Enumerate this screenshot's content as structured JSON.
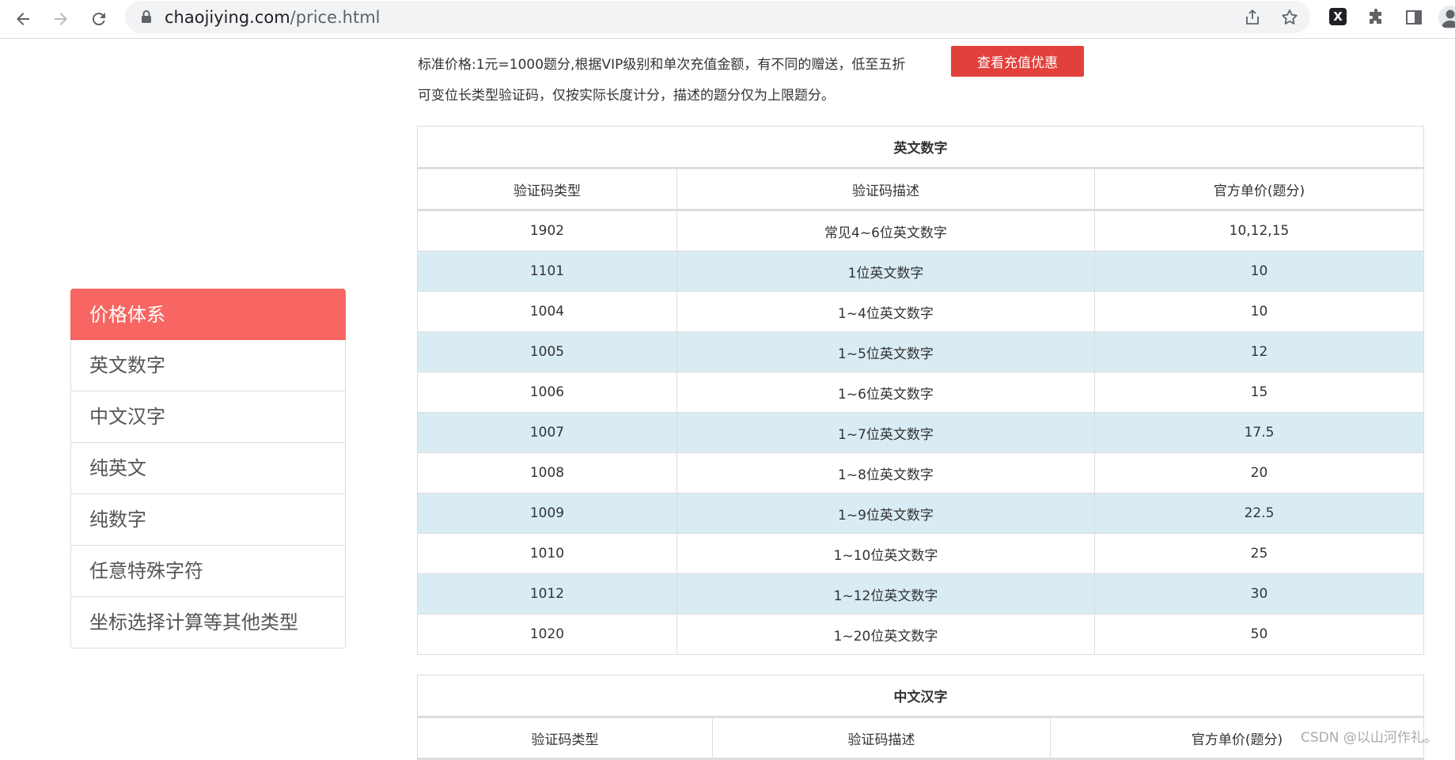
{
  "browser": {
    "url_host": "chaojiying.com",
    "url_path": "/price.html"
  },
  "intro": {
    "line1": "标准价格:1元=1000题分,根据VIP级别和单次充值金额，有不同的赠送，低至五折",
    "line2": "可变位长类型验证码，仅按实际长度计分，描述的题分仅为上限题分。",
    "button_label": "查看充值优惠"
  },
  "sidebar": {
    "items": [
      {
        "label": "价格体系"
      },
      {
        "label": "英文数字"
      },
      {
        "label": "中文汉字"
      },
      {
        "label": "纯英文"
      },
      {
        "label": "纯数字"
      },
      {
        "label": "任意特殊字符"
      },
      {
        "label": "坐标选择计算等其他类型"
      }
    ]
  },
  "tables": [
    {
      "title": "英文数字",
      "headers": [
        "验证码类型",
        "验证码描述",
        "官方单价(题分)"
      ],
      "rows": [
        [
          "1902",
          "常见4~6位英文数字",
          "10,12,15"
        ],
        [
          "1101",
          "1位英文数字",
          "10"
        ],
        [
          "1004",
          "1~4位英文数字",
          "10"
        ],
        [
          "1005",
          "1~5位英文数字",
          "12"
        ],
        [
          "1006",
          "1~6位英文数字",
          "15"
        ],
        [
          "1007",
          "1~7位英文数字",
          "17.5"
        ],
        [
          "1008",
          "1~8位英文数字",
          "20"
        ],
        [
          "1009",
          "1~9位英文数字",
          "22.5"
        ],
        [
          "1010",
          "1~10位英文数字",
          "25"
        ],
        [
          "1012",
          "1~12位英文数字",
          "30"
        ],
        [
          "1020",
          "1~20位英文数字",
          "50"
        ]
      ]
    },
    {
      "title": "中文汉字",
      "headers": [
        "验证码类型",
        "验证码描述",
        "官方单价(题分)"
      ]
    }
  ],
  "watermark": "CSDN @以山河作礼。",
  "colors": {
    "sidebar_active": "#f76662",
    "button": "#e2403b",
    "row_alt": "#d9ecf4"
  }
}
